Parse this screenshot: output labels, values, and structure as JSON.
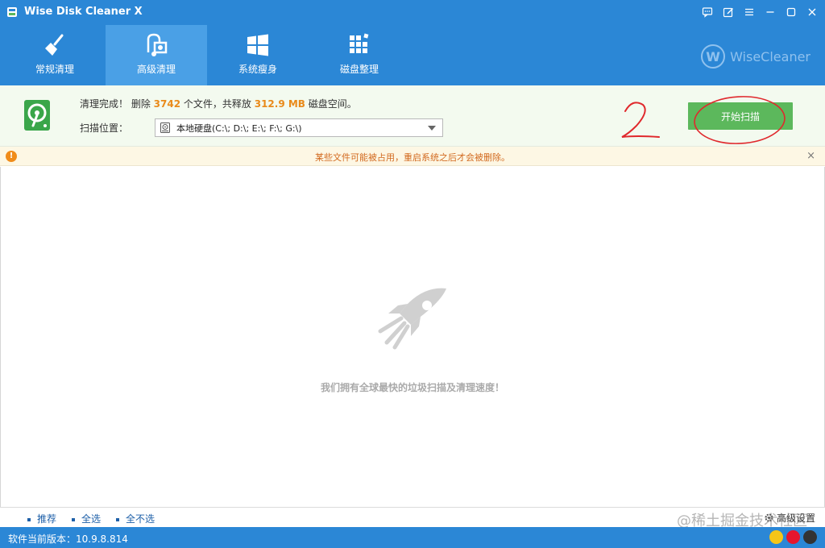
{
  "window": {
    "title": "Wise Disk Cleaner X",
    "controls": [
      "feedback-icon",
      "edit-icon",
      "menu-icon",
      "minimize-icon",
      "maximize-icon",
      "close-icon"
    ]
  },
  "tabs": [
    {
      "label": "常规清理",
      "icon": "broom-icon",
      "active": false
    },
    {
      "label": "高级清理",
      "icon": "vacuum-icon",
      "active": true
    },
    {
      "label": "系统瘦身",
      "icon": "windows-icon",
      "active": false
    },
    {
      "label": "磁盘整理",
      "icon": "defrag-icon",
      "active": false
    }
  ],
  "brand": {
    "logo_letter": "W",
    "name": "WiseCleaner"
  },
  "result": {
    "prefix": "清理完成！ 删除",
    "files": "3742",
    "mid": "个文件，共释放",
    "size": "312.9 MB",
    "suffix": "磁盘空间。"
  },
  "scan_location": {
    "label": "扫描位置：",
    "value": "本地硬盘(C:\\; D:\\; E:\\; F:\\; G:\\)"
  },
  "scan_button": "开始扫描",
  "annotation": "2",
  "notice": {
    "message": "某些文件可能被占用，重启系统之后才会被删除。",
    "close": "×"
  },
  "main": {
    "slogan": "我们拥有全球最快的垃圾扫描及清理速度！"
  },
  "actions": {
    "recommend": "推荐",
    "select_all": "全选",
    "select_none": "全不选",
    "advanced": "高级设置"
  },
  "watermark": "@稀土掘金技术社区",
  "footer": {
    "version": "软件当前版本：10.9.8.814"
  },
  "colors": {
    "header": "#2b87d6",
    "active_tab": "#4aa0e6",
    "scan_button": "#5cb85c",
    "highlight": "#e98a1a",
    "notice_text": "#d2691e",
    "annotation": "#e0282c"
  }
}
